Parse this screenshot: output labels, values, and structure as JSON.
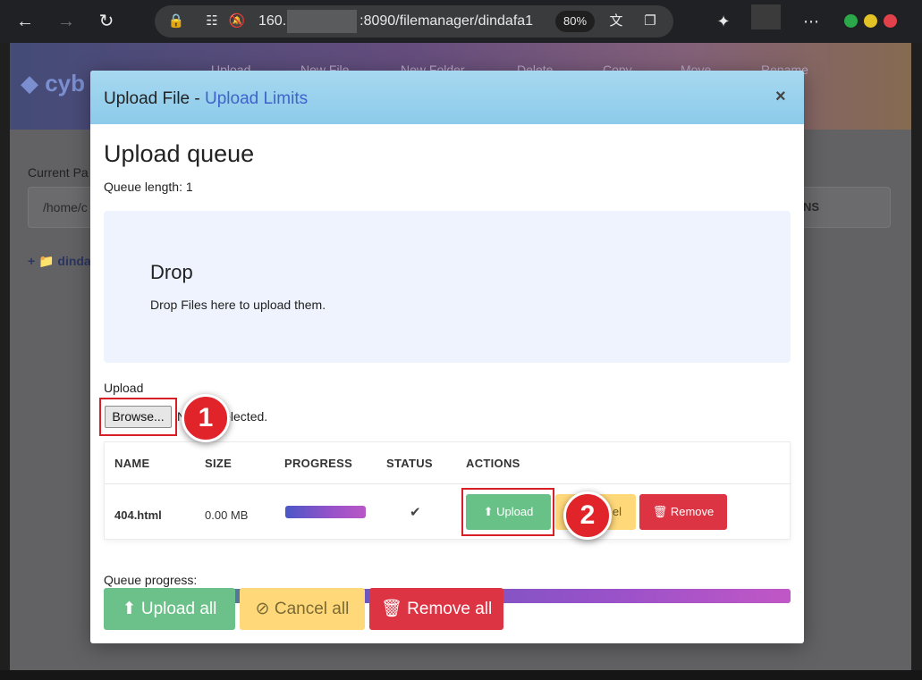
{
  "browser": {
    "url_prefix": "160.",
    "url_suffix": ":8090/filemanager/dindafa1",
    "zoom": "80%"
  },
  "background_page": {
    "logo_text": "cyb",
    "toolbar": [
      "Upload",
      "New File",
      "New Folder",
      "Delete",
      "Copy",
      "Move",
      "Rename"
    ],
    "current_path_label": "Current Pa",
    "path_value": "/home/c",
    "table_header_fragment": "NS",
    "tree_item": "dinda"
  },
  "modal": {
    "title_prefix": "Upload File - ",
    "title_link": "Upload Limits",
    "close_glyph": "×",
    "queue_heading": "Upload queue",
    "queue_length": "Queue length: 1",
    "dropzone": {
      "title": "Drop",
      "text": "Drop Files here to upload them."
    },
    "upload_label": "Upload",
    "browse_label": "Browse...",
    "file_status": "N         selected.",
    "table": {
      "headers": [
        "NAME",
        "SIZE",
        "PROGRESS",
        "STATUS",
        "ACTIONS"
      ],
      "rows": [
        {
          "name": "404.html",
          "size": "0.00 MB",
          "progress": 1.0,
          "status_icon": "check-icon",
          "actions": {
            "upload": "Upload",
            "cancel_visible": "el",
            "remove": "Remove"
          }
        }
      ]
    },
    "queue_progress_label": "Queue progress:",
    "queue_progress": 1.0,
    "bottom_buttons": {
      "upload_all": "Upload all",
      "cancel_all": "Cancel all",
      "remove_all": "Remove all"
    }
  },
  "annotations": {
    "badge_1": "1",
    "badge_2": "2"
  },
  "colors": {
    "header_bg": "#a7d8f0",
    "link": "#3f63c9",
    "success": "#68c288",
    "warning": "#ffd87a",
    "danger": "#dd3444",
    "annotation_red": "#e0242a"
  }
}
